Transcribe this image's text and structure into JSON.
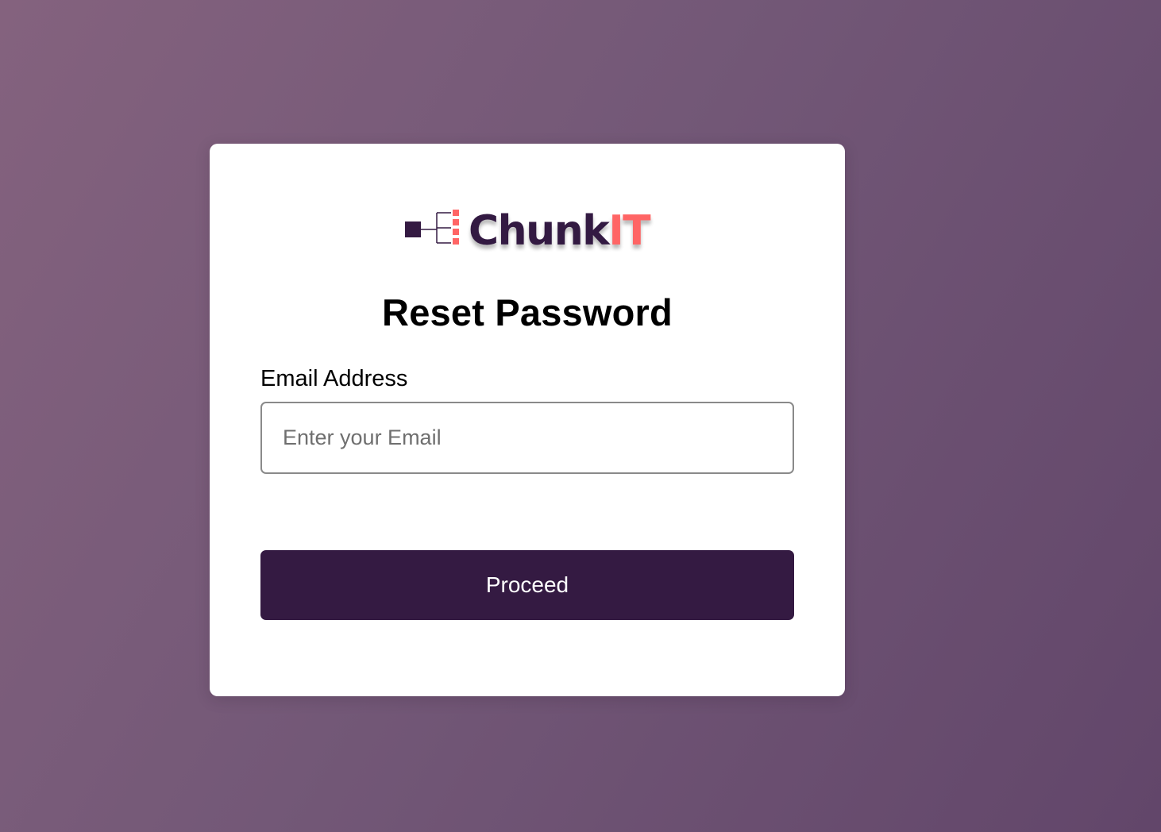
{
  "brand": {
    "name_main": "Chunk",
    "name_accent": "IT",
    "colors": {
      "primary": "#341a42",
      "accent": "#ff6565"
    },
    "logo_icon": "chunk-tree-icon"
  },
  "form": {
    "title": "Reset Password",
    "email": {
      "label": "Email Address",
      "placeholder": "Enter your Email",
      "value": ""
    },
    "submit_label": "Proceed"
  },
  "theme": {
    "background_start": "#84627e",
    "background_end": "#62466a",
    "card_background": "#ffffff"
  }
}
